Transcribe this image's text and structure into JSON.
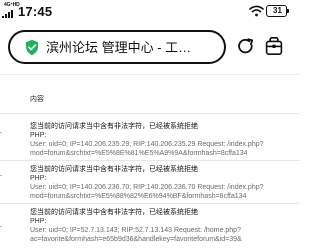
{
  "status_bar": {
    "network": "4G⁺HD",
    "time": "17:45",
    "battery": "31"
  },
  "browser": {
    "url_title": "滨州论坛 管理中心 - 工…",
    "icons": {
      "security": "shield-check-icon",
      "reload": "reload-icon",
      "toolbox": "toolbox-icon"
    }
  },
  "table": {
    "header": {
      "content": "内容"
    },
    "rows": [
      {
        "title": "您当前的访问请求当中含有非法字符，已经被系统拒绝",
        "php": "PHP:",
        "line1": "User: uid=0; IP=140.206.235.29; RIP:140.206.235.29 Request: /index.php?",
        "line2": "mod=forum&srchtxt=%E5%8E%81%E5%A9%9A&formhash=8cffa134"
      },
      {
        "title": "您当前的访问请求当中含有非法字符，已经被系统拒绝",
        "php": "PHP:",
        "line1": "User: uid=0; IP=140.206.236.70; RIP:140.206.236.70 Request: /index.php?",
        "line2": "mod=forum&srchtxt=%E5%88%82%E6%94%BF&formhash=8cffa134"
      },
      {
        "title": "您当前的访问请求当中含有非法字符，已经被系统拒绝",
        "php": "PHP:",
        "line1": "User: uid=0; IP=52.7.13.143; RIP:52.7.13.143 Request: /home.php?",
        "line2": "ac=favorite&formhash=e65b9d36&handlekey=favoriteforum&id=39&",
        "line3": ""
      }
    ]
  },
  "colors": {
    "accent_green": "#1fb45a",
    "text_primary": "#111111",
    "text_secondary": "#6a6a6a",
    "divider": "#e7e7e7"
  }
}
